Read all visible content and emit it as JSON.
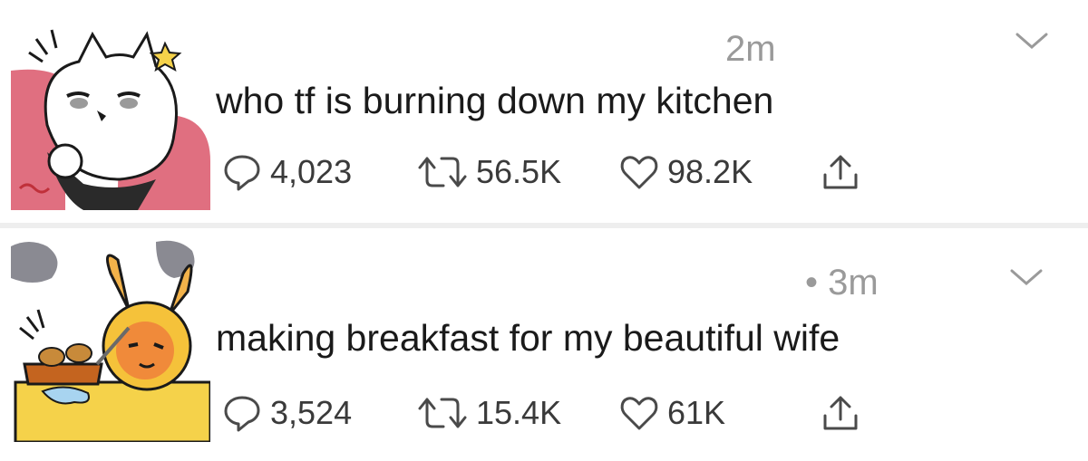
{
  "tweets": [
    {
      "time": "2m",
      "text": "who tf is burning down my kitchen",
      "replies": "4,023",
      "retweets": "56.5K",
      "likes": "98.2K",
      "avatar": "white-dog-cartoon"
    },
    {
      "time": "• 3m",
      "text": "making breakfast for my beautiful wife",
      "replies": "3,524",
      "retweets": "15.4K",
      "likes": "61K",
      "avatar": "orange-fox-cooking-cartoon"
    }
  ],
  "icons": {
    "reply": "reply-icon",
    "retweet": "retweet-icon",
    "like": "heart-icon",
    "share": "share-icon",
    "menu": "chevron-down-icon"
  },
  "colors": {
    "text": "#1a1a1a",
    "meta": "#9a9a9a",
    "icon": "#4a4a4a",
    "divider": "#eeeeee"
  }
}
